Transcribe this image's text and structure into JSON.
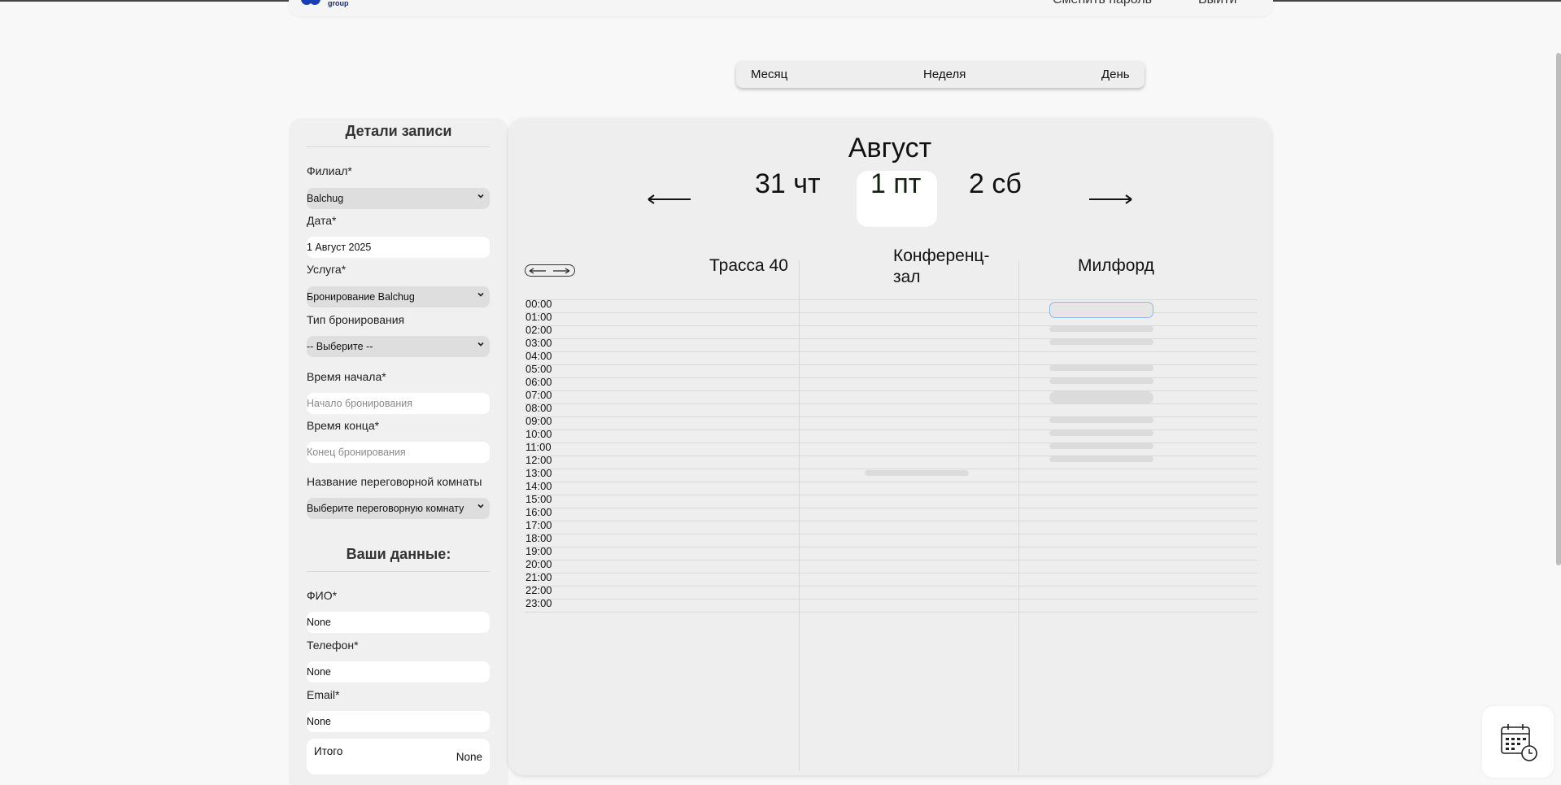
{
  "header": {
    "logo_text": "group",
    "link_change_password": "Сменить пароль",
    "link_logout": "Выйти"
  },
  "view_switcher": {
    "month": "Месяц",
    "week": "Неделя",
    "day": "День",
    "active": "День"
  },
  "form": {
    "title": "Детали записи",
    "branch_label": "Филиал*",
    "branch_value": "Balchug",
    "date_label": "Дата*",
    "date_value": "1 Август 2025",
    "service_label": "Услуга*",
    "service_value": "Бронирование Balchug",
    "booking_type_label": "Тип бронирования",
    "booking_type_value": "-- Выберите --",
    "start_label": "Время начала*",
    "start_placeholder": "Начало бронирования",
    "end_label": "Время конца*",
    "end_placeholder": "Конец бронирования",
    "room_label": "Название переговорной комнаты",
    "room_value": "Выберите переговорную комнату",
    "your_data_title": "Ваши данные:",
    "fio_label": "ФИО*",
    "fio_value": "None",
    "phone_label": "Телефон*",
    "phone_value": "None",
    "email_label": "Email*",
    "email_value": "None",
    "total_label": "Итого",
    "total_value": "None"
  },
  "schedule": {
    "month": "Август",
    "days": [
      "31 чт",
      "1 пт",
      "2 сб"
    ],
    "selected_day": "1 пт",
    "rooms": [
      "Трасса 40",
      "Конференц-\nзал",
      "Милфорд"
    ],
    "room_1": "Трасса 40",
    "room_2_line1": "Конференц-",
    "room_2_line2": "зал",
    "room_3": "Милфорд",
    "hours": [
      "00:00",
      "01:00",
      "02:00",
      "03:00",
      "04:00",
      "05:00",
      "06:00",
      "07:00",
      "08:00",
      "09:00",
      "10:00",
      "11:00",
      "12:00",
      "13:00",
      "14:00",
      "15:00",
      "16:00",
      "17:00",
      "18:00",
      "19:00",
      "20:00",
      "21:00",
      "22:00",
      "23:00"
    ]
  },
  "icons": {
    "prev": "arrow-left-icon",
    "next": "arrow-right-icon",
    "widget": "calendar-clock-icon"
  }
}
